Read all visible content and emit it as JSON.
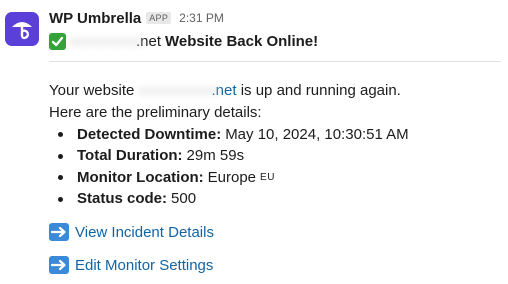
{
  "message": {
    "sender": "WP Umbrella",
    "app_badge": "APP",
    "time": "2:31 PM",
    "title_domain_suffix": ".net",
    "title_text": "Website Back Online!",
    "body_prefix": "Your website",
    "body_domain_suffix": ".net",
    "body_suffix": "is up and running again.",
    "details_intro": "Here are the preliminary details:",
    "details": [
      {
        "label": "Detected Downtime:",
        "value": "May 10, 2024, 10:30:51 AM"
      },
      {
        "label": "Total Duration:",
        "value": "29m 59s"
      },
      {
        "label": "Monitor Location:",
        "value": "Europe",
        "extra": "EU"
      },
      {
        "label": "Status code:",
        "value": "500"
      }
    ],
    "actions": [
      {
        "label": "View Incident Details",
        "icon": "right-arrow-emoji"
      },
      {
        "label": "Edit Monitor Settings",
        "icon": "right-arrow-emoji"
      }
    ]
  },
  "colors": {
    "avatar_bg": "#5b3fd9",
    "link": "#1264a3",
    "check_green": "#35a33a",
    "arrow_blue": "#3b8ad9"
  }
}
